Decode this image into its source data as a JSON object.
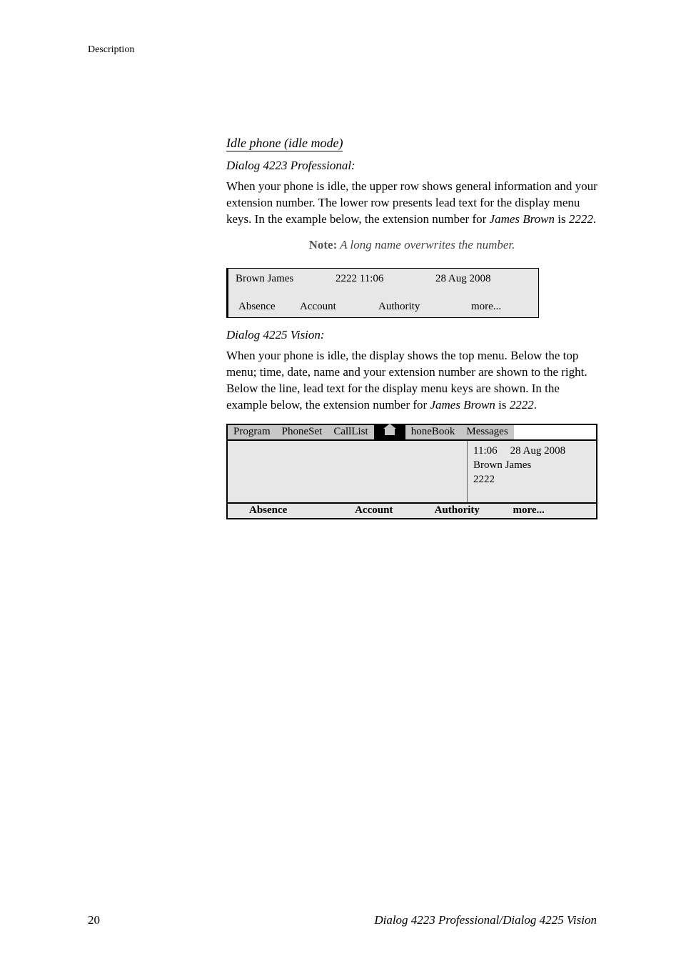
{
  "header_label": "Description",
  "section_title": "Idle phone (idle mode)",
  "sub1": "Dialog 4223 Professional:",
  "para1_a": "When your phone is idle, the upper row shows general information and your extension number. The lower row presents lead text for the display menu keys. In the example below, the extension number for ",
  "para1_b": "James Brown",
  "para1_c": " is ",
  "para1_d": "2222",
  "para1_e": ".",
  "note_bold": "Note:",
  "note_ital": " A long name overwrites the number.",
  "d4223": {
    "name": "Brown James",
    "ext_time": "2222 11:06",
    "date": "28 Aug 2008",
    "s1": "Absence",
    "s2": "Account",
    "s3": "Authority",
    "s4": "more..."
  },
  "sub2": "Dialog 4225 Vision:",
  "para2_a": "When your phone is idle, the display shows the top menu. Below the top menu; time, date, name and your extension number are shown to the right. Below the line, lead text for the display menu keys are shown. In the example below, the extension number for ",
  "para2_b": "James Brown",
  "para2_c": " is ",
  "para2_d": "2222",
  "para2_e": ".",
  "d4225": {
    "m1": "Program",
    "m2": "PhoneSet",
    "m3": "CallList",
    "m4": "honeBook",
    "m5": "Messages",
    "time": "11:06",
    "date": "28 Aug 2008",
    "name": "Brown James",
    "ext": "2222",
    "s1": "Absence",
    "s2": "Account",
    "s3": "Authority",
    "s4": "more..."
  },
  "footer_page": "20",
  "footer_title": "Dialog 4223 Professional/Dialog 4225 Vision"
}
